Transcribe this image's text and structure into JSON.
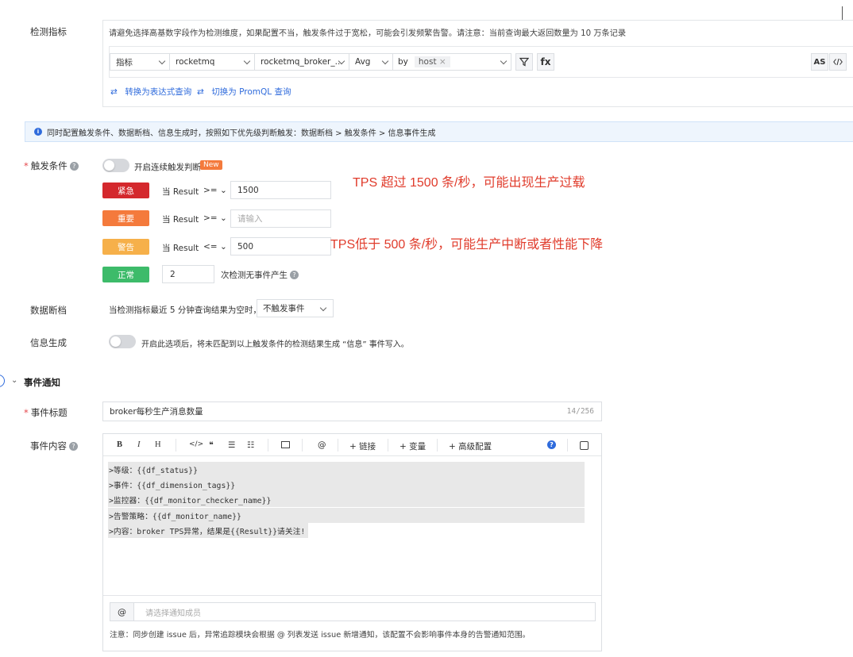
{
  "corner_icon": "panel-icon",
  "metric": {
    "label": "检测指标",
    "hint": "请避免选择高基数字段作为检测维度，如果配置不当，触发条件过于宽松，可能会引发频繁告警。请注意：当前查询最大返回数量为 10 万条记录",
    "query": {
      "type": "指标",
      "namespace": "rocketmq",
      "metric": "rocketmq_broker_...",
      "agg": "Avg",
      "by_label": "by",
      "by_tag": "host",
      "filter_icon": "filter-icon",
      "fx": "fx",
      "as": "AS",
      "code_icon": "code-icon"
    },
    "switch_expr": "转换为表达式查询",
    "switch_promql": "切换为 PromQL 查询"
  },
  "info_banner": "同时配置触发条件、数据断档、信息生成时，按照如下优先级判断触发：数据断档 > 触发条件 > 信息事件生成",
  "trigger": {
    "label": "触发条件",
    "continuous_label": "开启连续触发判断",
    "new_badge": "New",
    "rows": [
      {
        "level": "紧急",
        "cond": "当 Result",
        "op": ">=",
        "value": "1500",
        "placeholder": ""
      },
      {
        "level": "重要",
        "cond": "当 Result",
        "op": ">=",
        "value": "",
        "placeholder": "请输入"
      },
      {
        "level": "警告",
        "cond": "当 Result",
        "op": "<=",
        "value": "500",
        "placeholder": ""
      }
    ],
    "normal_level": "正常",
    "normal_count": "2",
    "normal_suffix": "次检测无事件产生",
    "colors": {
      "urgent": "#d4282d",
      "important": "#f47a3c",
      "warning": "#f6b04a",
      "normal": "#3dbb6a"
    }
  },
  "annotations": {
    "a1": "TPS 超过 1500 条/秒，可能出现生产过载",
    "a2": "TPS低于 500 条/秒，可能生产中断或者性能下降"
  },
  "nodata": {
    "label": "数据断档",
    "text": "当检测指标最近 5 分钟查询结果为空时，",
    "select": "不触发事件"
  },
  "info_gen": {
    "label": "信息生成",
    "text": "开启此选项后，将未匹配到以上触发条件的检测结果生成 “信息” 事件写入。"
  },
  "notify": {
    "section_title": "事件通知",
    "title_label": "事件标题",
    "title_value": "broker每秒生产消息数量",
    "title_count": "14/256",
    "content_label": "事件内容",
    "toolbar": {
      "bold": "B",
      "italic": "I",
      "heading": "H",
      "code": "</>",
      "quote": "❝",
      "ul": "☰",
      "ol": "☷",
      "image": "image-icon",
      "mention": "@",
      "link": "链接",
      "var": "变量",
      "advanced": "高级配置",
      "help": "?",
      "preview": "preview-icon"
    },
    "content_lines": [
      ">等级：{{df_status}}",
      ">事件：{{df_dimension_tags}}",
      ">监控器：{{df_monitor_checker_name}}",
      ">告警策略：{{df_monitor_name}}",
      ">内容：broker TPS异常，结果是{{Result}}请关注!"
    ],
    "at": "@",
    "member_placeholder": "请选择通知成员",
    "note": "注意：同步创建 issue 后，异常追踪模块会根据 @ 列表发送 issue 新增通知，该配置不会影响事件本身的告警通知范围。"
  }
}
